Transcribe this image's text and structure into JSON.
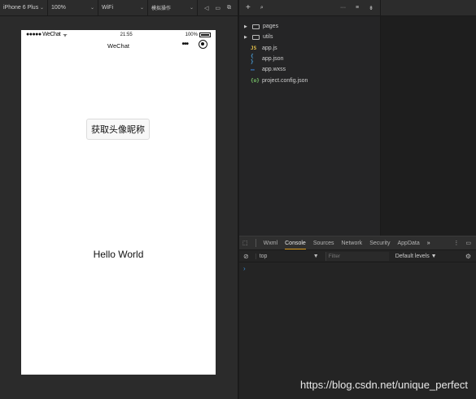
{
  "toolbar": {
    "device": "iPhone 6 Plus",
    "zoom": "100%",
    "network": "WiFi",
    "mode": "模拟操作"
  },
  "phone": {
    "status": {
      "signal": "●●●●● WeChat",
      "wifi": "ᯤ",
      "time": "21:55",
      "battery": "100%"
    },
    "nav_title": "WeChat",
    "profile_button": "获取头像昵称",
    "hello": "Hello World"
  },
  "explorer": {
    "items": [
      {
        "label": "pages",
        "kind": "folder"
      },
      {
        "label": "utils",
        "kind": "folder"
      },
      {
        "label": "app.js",
        "kind": "js",
        "icon": "JS"
      },
      {
        "label": "app.json",
        "kind": "json",
        "icon": "{ }"
      },
      {
        "label": "app.wxss",
        "kind": "wxss",
        "icon": "wxss"
      },
      {
        "label": "project.config.json",
        "kind": "conf",
        "icon": "{o}"
      }
    ]
  },
  "console": {
    "tabs": [
      "Wxml",
      "Console",
      "Sources",
      "Network",
      "Security",
      "AppData"
    ],
    "active_tab": "Console",
    "more": "»",
    "context": "top",
    "filter_placeholder": "Filter",
    "levels": "Default levels ▼",
    "prompt": "›"
  },
  "watermark": "https://blog.csdn.net/unique_perfect"
}
